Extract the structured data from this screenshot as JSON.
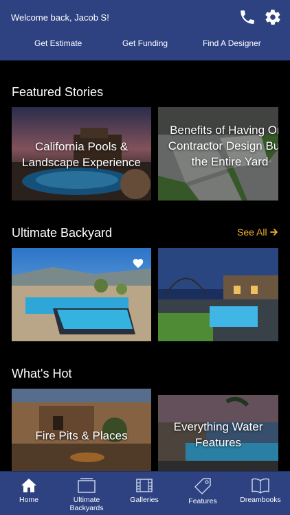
{
  "header": {
    "welcome": "Welcome back, Jacob S!",
    "phone_icon": "phone-icon",
    "settings_icon": "gear-icon",
    "quick_links": [
      "Get Estimate",
      "Get Funding",
      "Find A Designer"
    ]
  },
  "featured": {
    "title": "Featured Stories",
    "cards": [
      {
        "label": "California Pools & Landscape Experience"
      },
      {
        "label": "Benefits of Having One Contractor Design Build the Entire Yard"
      }
    ]
  },
  "ultimate": {
    "title": "Ultimate Backyard",
    "see_all": "See All",
    "favorite_icon": "heart-icon"
  },
  "hot": {
    "title": "What's Hot",
    "cards": [
      {
        "label": "Fire Pits & Places"
      },
      {
        "label": "Everything Water Features"
      }
    ]
  },
  "tabs": [
    {
      "label": "Home",
      "icon": "home-icon"
    },
    {
      "label": "Ultimate Backyards",
      "icon": "backyard-icon"
    },
    {
      "label": "Galleries",
      "icon": "film-icon"
    },
    {
      "label": "Features",
      "icon": "tag-icon"
    },
    {
      "label": "Dreambooks",
      "icon": "book-icon"
    }
  ],
  "colors": {
    "header": "#2e4282",
    "accent": "#f2b12e",
    "background": "#000000"
  }
}
